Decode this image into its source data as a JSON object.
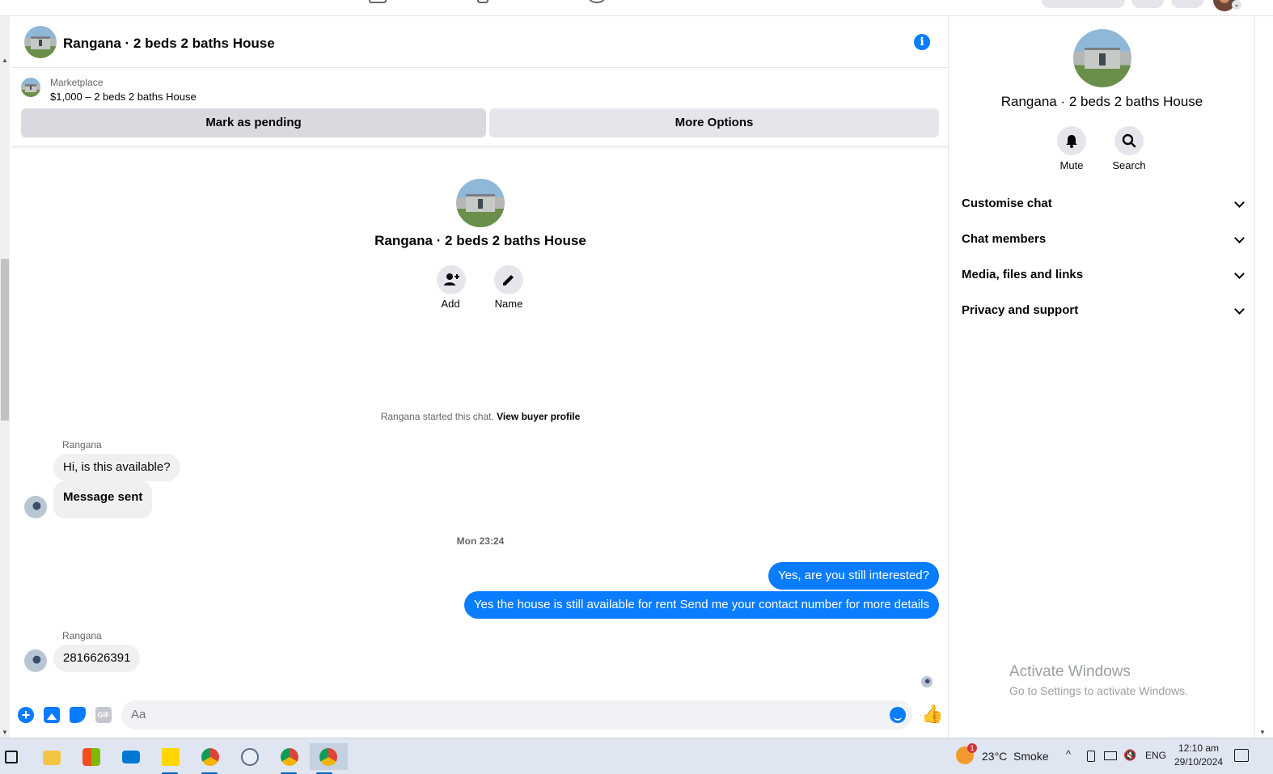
{
  "chat": {
    "title": "Rangana · 2 beds 2 baths House",
    "listing": {
      "label": "Marketplace",
      "price_title": "$1,000 – 2 beds 2 baths House",
      "pending_button": "Mark as pending",
      "more_button": "More Options"
    },
    "intro": {
      "title": "Rangana · 2 beds 2 baths House",
      "add_label": "Add",
      "name_label": "Name",
      "started_text": "Rangana started this chat.",
      "view_profile": "View buyer profile"
    },
    "messages": [
      {
        "sender": "Rangana",
        "text": "Hi, is this available?"
      },
      {
        "sender": "",
        "text": "Message sent"
      },
      {
        "timestamp": "Mon 23:24"
      },
      {
        "sender": "me",
        "text": "Yes, are you still interested?"
      },
      {
        "sender": "me",
        "text": "Yes the house is still available for rent Send me your contact number for more details"
      },
      {
        "sender": "Rangana",
        "text": "2816626391"
      }
    ],
    "composer": {
      "placeholder": "Aa"
    }
  },
  "panel": {
    "title": "Rangana · 2 beds 2 baths House",
    "mute_label": "Mute",
    "search_label": "Search",
    "sections": [
      "Customise chat",
      "Chat members",
      "Media, files and links",
      "Privacy and support"
    ],
    "watermark_title": "Activate Windows",
    "watermark_sub": "Go to Settings to activate Windows."
  },
  "taskbar": {
    "weather": "23°C  Smoke",
    "weather_badge": "1",
    "language": "ENG",
    "time": "12:10 am",
    "date": "29/10/2024"
  },
  "colors": {
    "accent": "#0a7cff",
    "bubble_in": "#f0f0f0",
    "taskbar": "#dfe6f1"
  }
}
